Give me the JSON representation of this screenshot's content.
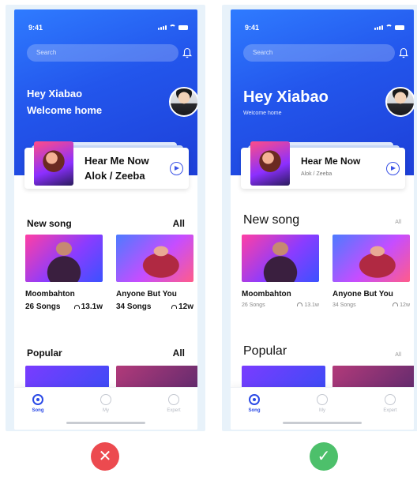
{
  "screens": [
    {
      "status_time": "9:41",
      "search_placeholder": "Search",
      "greeting_line1": "Hey Xiabao",
      "greeting_line2": "Welcome home",
      "now_playing": {
        "title": "Hear Me Now",
        "artist": "Alok / Zeeba"
      },
      "new_song_title": "New song",
      "new_song_all": "All",
      "songs": [
        {
          "name": "Moombahton",
          "count": "26 Songs",
          "plays": "13.1w"
        },
        {
          "name": "Anyone But You",
          "count": "34 Songs",
          "plays": "12w"
        }
      ],
      "popular_title": "Popular",
      "popular_all": "All",
      "tabs": [
        {
          "label": "Song",
          "icon": "disc-icon"
        },
        {
          "label": "My",
          "icon": "user-icon"
        },
        {
          "label": "Expert",
          "icon": "headphones-icon"
        }
      ]
    },
    {
      "status_time": "9:41",
      "search_placeholder": "Search",
      "greeting_line1": "Hey Xiabao",
      "greeting_line2": "Welcome home",
      "now_playing": {
        "title": "Hear Me Now",
        "artist": "Alok / Zeeba"
      },
      "new_song_title": "New song",
      "new_song_all": "All",
      "songs": [
        {
          "name": "Moombahton",
          "count": "26 Songs",
          "plays": "13.1w"
        },
        {
          "name": "Anyone But You",
          "count": "34 Songs",
          "plays": "12w"
        }
      ],
      "popular_title": "Popular",
      "popular_all": "All",
      "tabs": [
        {
          "label": "Song",
          "icon": "disc-icon"
        },
        {
          "label": "My",
          "icon": "user-icon"
        },
        {
          "label": "Expert",
          "icon": "headphones-icon"
        }
      ]
    }
  ],
  "verdicts": {
    "incorrect": "✕",
    "correct": "✓"
  },
  "colors": {
    "brand_blue": "#2356ec",
    "incorrect": "#ec4a4f",
    "correct": "#4dc06b",
    "panel_bg": "#e8f2fa"
  }
}
